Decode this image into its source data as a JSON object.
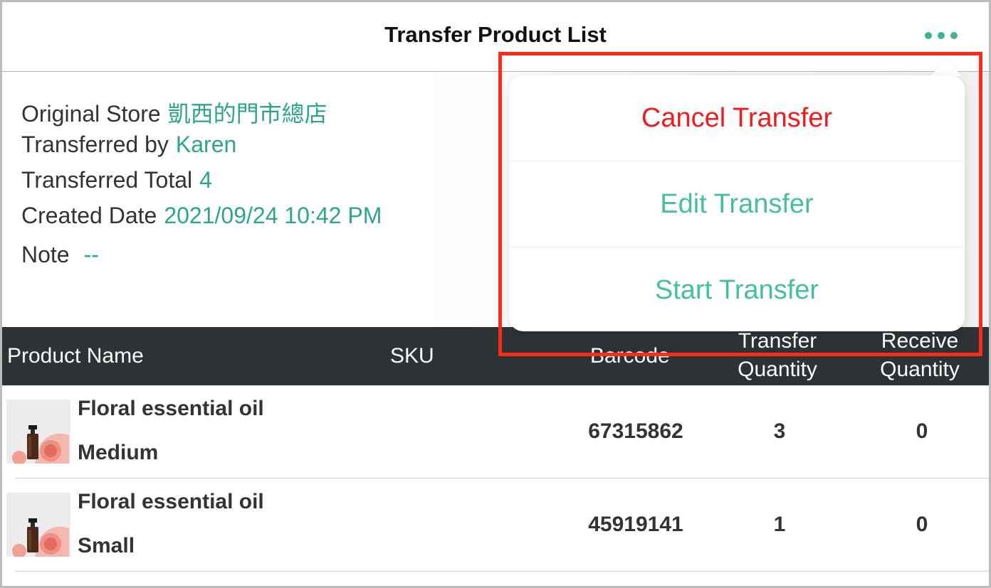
{
  "header": {
    "title": "Transfer Product List",
    "more_icon": "ellipsis-icon"
  },
  "info": {
    "original_store": {
      "label": "Original Store",
      "value": "凱西的門市總店"
    },
    "transferred_by": {
      "label": "Transferred by",
      "value": "Karen"
    },
    "transferred_total": {
      "label": "Transferred Total",
      "value": "4"
    },
    "created_date": {
      "label": "Created Date",
      "value": "2021/09/24 10:42 PM"
    },
    "note": {
      "label": "Note",
      "value": "--"
    }
  },
  "table": {
    "columns": {
      "product_name": "Product Name",
      "sku": "SKU",
      "barcode": "Barcode",
      "transfer_qty_1": "Transfer",
      "transfer_qty_2": "Quantity",
      "receive_qty_1": "Receive",
      "receive_qty_2": "Quantity"
    },
    "rows": [
      {
        "name": "Floral essential oil",
        "variant": "Medium",
        "sku": "",
        "barcode": "67315862",
        "transfer_qty": "3",
        "receive_qty": "0"
      },
      {
        "name": "Floral essential oil",
        "variant": "Small",
        "sku": "",
        "barcode": "45919141",
        "transfer_qty": "1",
        "receive_qty": "0"
      }
    ]
  },
  "popover": {
    "items": [
      {
        "label": "Cancel Transfer",
        "style": "destructive"
      },
      {
        "label": "Edit Transfer",
        "style": "default"
      },
      {
        "label": "Start Transfer",
        "style": "default"
      }
    ]
  },
  "colors": {
    "accent": "#2ea58a",
    "popover_text": "#46c09b",
    "destructive": "#ee1c1c",
    "table_header_bg": "#2d3235",
    "highlight_border": "#ff2a1a"
  }
}
